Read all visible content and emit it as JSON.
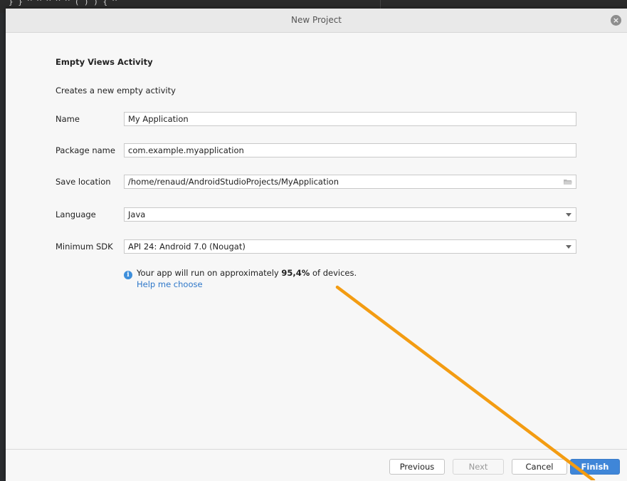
{
  "background": {
    "code_snippet": "} } ^ ^ ^ ^ ^ ( ) ) { ^"
  },
  "dialog": {
    "title": "New Project",
    "heading": "Empty Views Activity",
    "description": "Creates a new empty activity",
    "fields": {
      "name": {
        "label": "Name",
        "value": "My Application"
      },
      "package": {
        "label": "Package name",
        "value": "com.example.myapplication"
      },
      "save_location": {
        "label": "Save location",
        "value": "/home/renaud/AndroidStudioProjects/MyApplication"
      },
      "language": {
        "label": "Language",
        "value": "Java"
      },
      "min_sdk": {
        "label": "Minimum SDK",
        "value": "API 24: Android 7.0 (Nougat)"
      }
    },
    "info": {
      "prefix": "Your app will run on approximately ",
      "percent": "95,4%",
      "suffix": " of devices.",
      "help_link": "Help me choose"
    },
    "buttons": {
      "previous": "Previous",
      "next": "Next",
      "cancel": "Cancel",
      "finish": "Finish"
    }
  },
  "annotation": {
    "arrow_color": "#f39c12"
  },
  "colors": {
    "link": "#2e77c9",
    "primary_button": "#3f86d8",
    "info_icon": "#3e8fdb"
  }
}
